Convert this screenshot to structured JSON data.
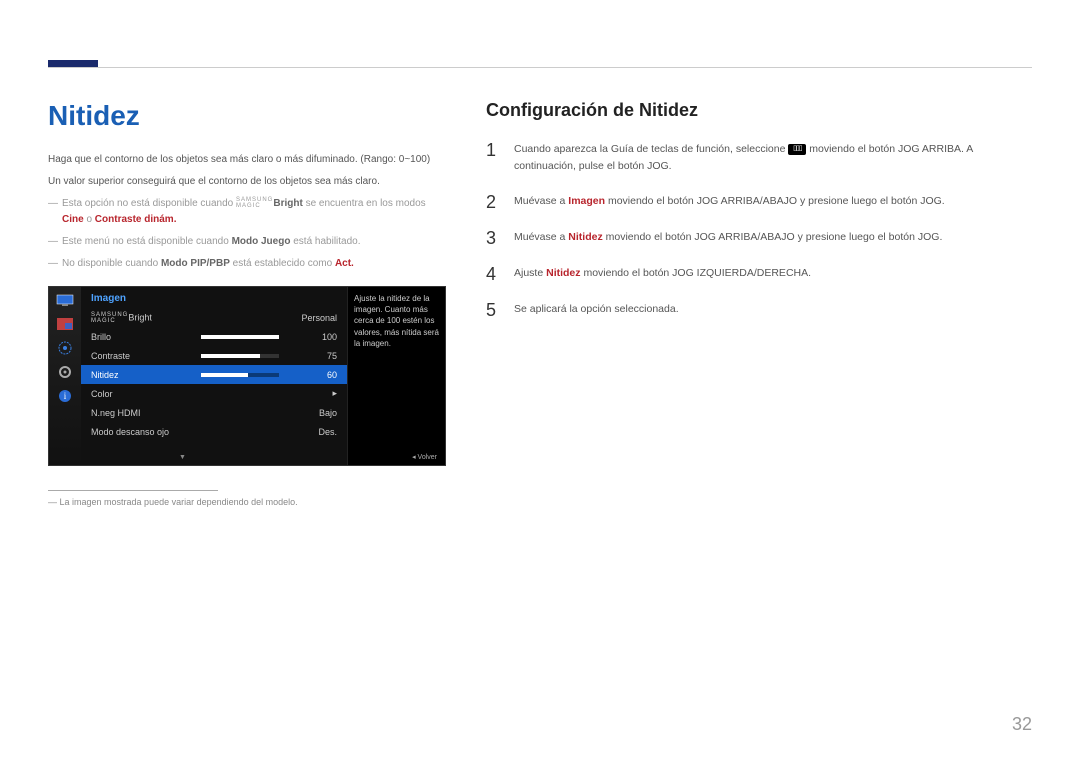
{
  "page_number": "32",
  "left": {
    "title": "Nitidez",
    "intro1": "Haga que el contorno de los objetos sea más claro o más difuminado. (Rango: 0~100)",
    "intro2": "Un valor superior conseguirá que el contorno de los objetos sea más claro.",
    "note1_a": "Esta opción no está disponible cuando ",
    "note1_b": "Bright",
    "note1_c": " se encuentra en los modos ",
    "note1_d": "Cine",
    "note1_e": " o ",
    "note1_f": "Contraste dinám.",
    "note2_a": "Este menú no está disponible cuando ",
    "note2_b": "Modo Juego",
    "note2_c": " está habilitado.",
    "note3_a": "No disponible cuando ",
    "note3_b": "Modo PIP/PBP",
    "note3_c": " está establecido como ",
    "note3_d": "Act.",
    "footnote": "La imagen mostrada puede variar dependiendo del modelo."
  },
  "osd": {
    "tab": "Imagen",
    "desc": "Ajuste la nitidez de la imagen. Cuanto más cerca de 100 estén los valores, más nítida será la imagen.",
    "rows": {
      "bright_label": "Bright",
      "bright_val": "Personal",
      "brillo_label": "Brillo",
      "brillo_val": "100",
      "contraste_label": "Contraste",
      "contraste_val": "75",
      "nitidez_label": "Nitidez",
      "nitidez_val": "60",
      "color_label": "Color",
      "color_val": "▸",
      "nneg_label": "N.neg HDMI",
      "nneg_val": "Bajo",
      "descanso_label": "Modo descanso ojo",
      "descanso_val": "Des."
    },
    "scroll": "▼",
    "footer": "◂   Volver"
  },
  "right": {
    "title": "Configuración de Nitidez",
    "steps": {
      "s1_a": "Cuando aparezca la Guía de teclas de función, seleccione ",
      "s1_b": " moviendo el botón JOG ARRIBA. A continuación, pulse el botón JOG.",
      "s2_a": "Muévase a ",
      "s2_b": "Imagen",
      "s2_c": " moviendo el botón JOG ARRIBA/ABAJO y presione luego el botón JOG.",
      "s3_a": "Muévase a ",
      "s3_b": "Nitidez",
      "s3_c": " moviendo el botón JOG ARRIBA/ABAJO y presione luego el botón JOG.",
      "s4_a": "Ajuste ",
      "s4_b": "Nitidez",
      "s4_c": " moviendo el botón JOG IZQUIERDA/DERECHA.",
      "s5": "Se aplicará la opción seleccionada."
    },
    "nums": {
      "n1": "1",
      "n2": "2",
      "n3": "3",
      "n4": "4",
      "n5": "5"
    }
  },
  "magic": {
    "top": "SAMSUNG",
    "bot": "MAGIC"
  }
}
